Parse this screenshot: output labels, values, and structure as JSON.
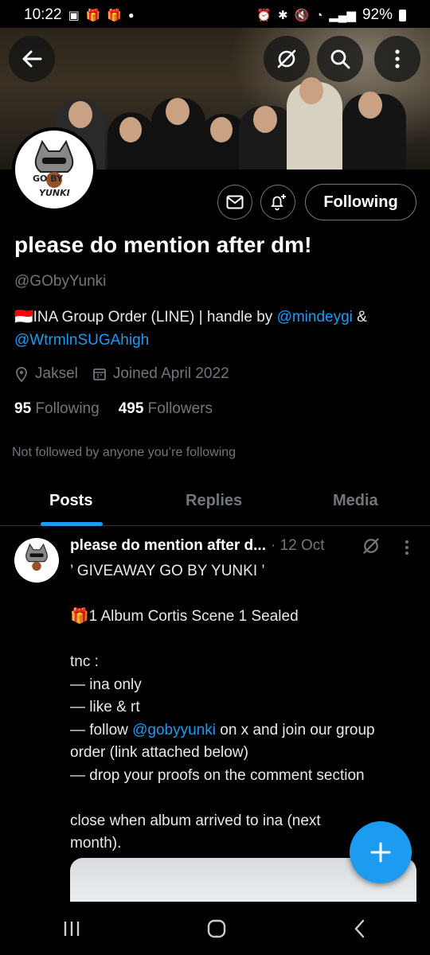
{
  "status_bar": {
    "time": "10:22",
    "battery": "92%"
  },
  "profile": {
    "follow_label": "Following",
    "name": "please do mention after dm!",
    "handle": "@GObyYunki",
    "bio_prefix": "🇮🇩INA Group Order (LINE) | handle by ",
    "bio_link1": "@mindeygi",
    "bio_amp": " &",
    "bio_link2": "@WtrmlnSUGAhigh",
    "location": "Jaksel",
    "joined": "Joined April 2022",
    "following_count": "95",
    "following_label": "Following",
    "followers_count": "495",
    "followers_label": "Followers",
    "not_followed_text": "Not followed by anyone you’re following",
    "avatar_text_top": "GO BY",
    "avatar_text_bottom": "YUNKI"
  },
  "tabs": [
    "Posts",
    "Replies",
    "Media"
  ],
  "post": {
    "author": "please do mention after d...",
    "date": "· 12 Oct",
    "lines": [
      "’ GIVEAWAY GO BY YUNKI ’",
      "",
      "🎁1 Album Cortis Scene 1 Sealed",
      "",
      "tnc :",
      "— ina only",
      "— like & rt",
      "",
      "order (link attached below)",
      "— drop your proofs on the comment section",
      "",
      "close when album arrived to ina (next",
      "month)."
    ],
    "follow_line_prefix": "— follow ",
    "follow_line_link": "@gobyyunki",
    "follow_line_suffix": " on x and join our group"
  },
  "colors": {
    "accent": "#1d9bf0",
    "muted": "#71767b",
    "background": "#000000"
  }
}
